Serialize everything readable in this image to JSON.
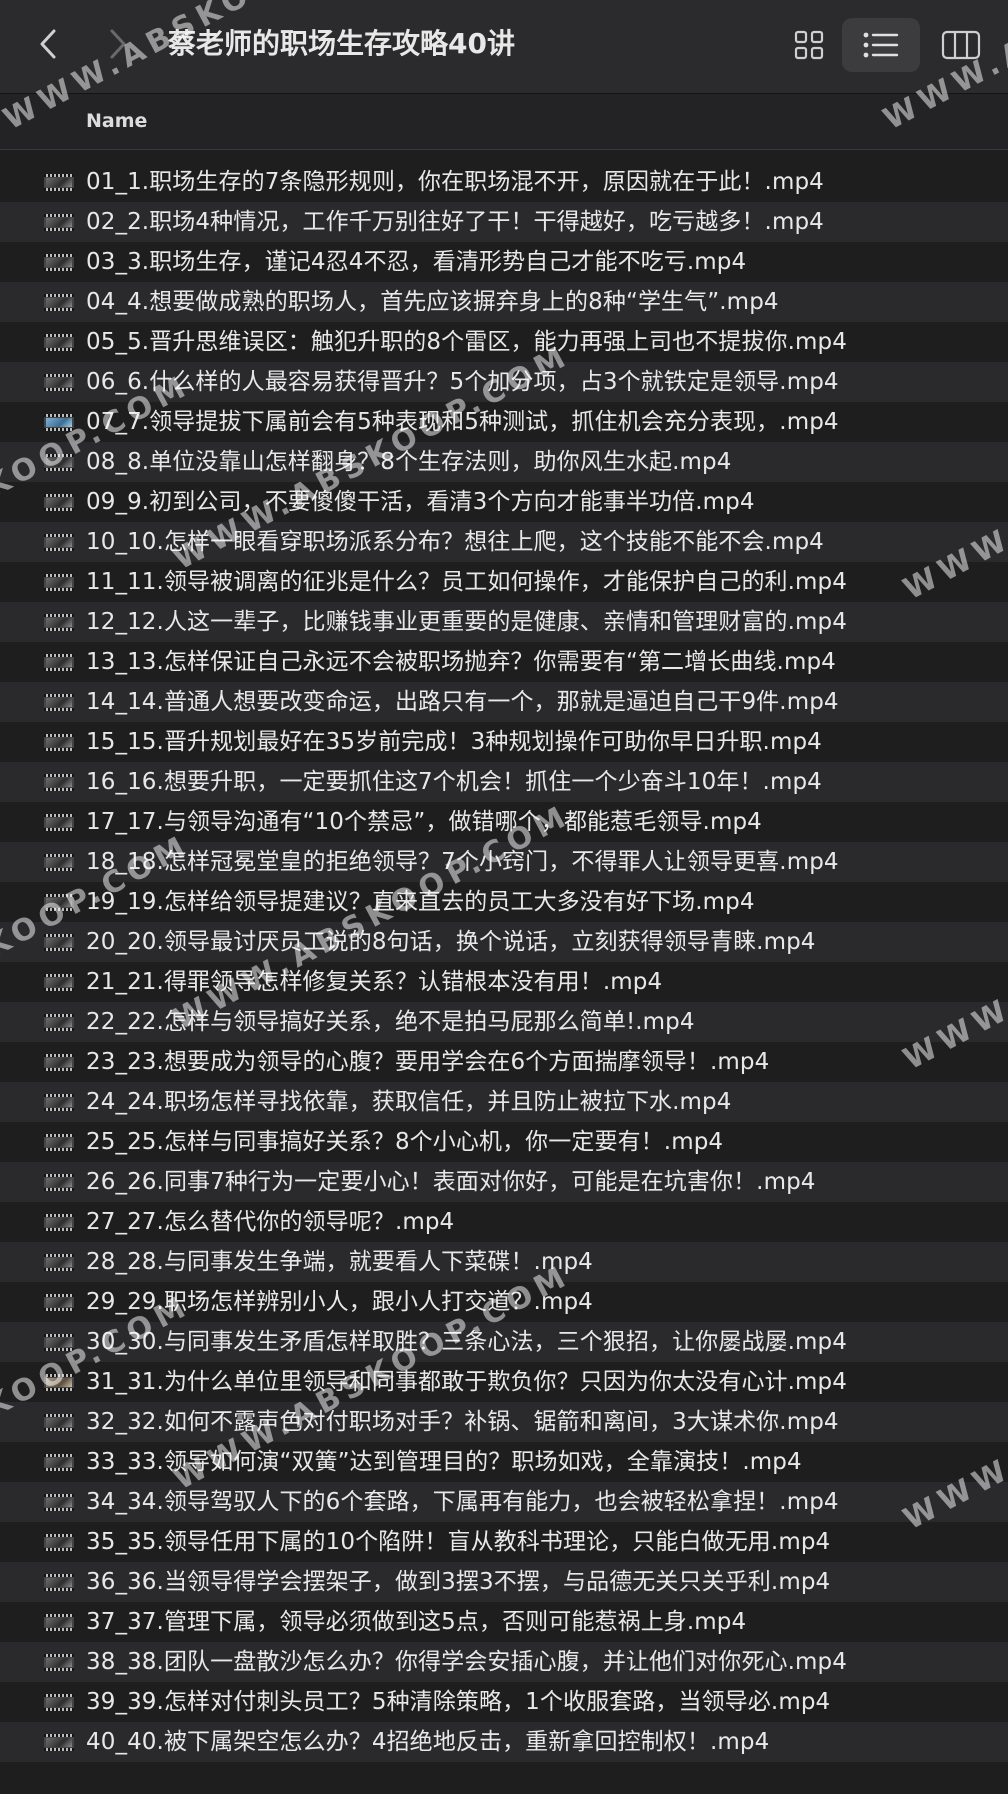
{
  "window": {
    "title": "蔡老师的职场生存攻略40讲"
  },
  "toolbar": {
    "back_icon": "chevron-left-icon",
    "forward_icon": "chevron-right-icon",
    "grid_icon": "grid-view-icon",
    "list_icon": "list-view-icon",
    "columns_icon": "column-view-icon",
    "active_view": "list"
  },
  "columns": {
    "name": "Name"
  },
  "files": [
    {
      "name": "01_1.职场生存的7条隐形规则，你在职场混不开，原因就在于此！.mp4",
      "thumb": "dark"
    },
    {
      "name": "02_2.职场4种情况，工作千万别往好了干！干得越好，吃亏越多！.mp4",
      "thumb": "dark"
    },
    {
      "name": "03_3.职场生存，谨记4忍4不忍，看清形势自己才能不吃亏.mp4",
      "thumb": "dark"
    },
    {
      "name": "04_4.想要做成熟的职场人，首先应该摒弃身上的8种“学生气”.mp4",
      "thumb": "dark"
    },
    {
      "name": "05_5.晋升思维误区：触犯升职的8个雷区，能力再强上司也不提拔你.mp4",
      "thumb": "dark"
    },
    {
      "name": "06_6.什么样的人最容易获得晋升？5个加分项，占3个就铁定是领导.mp4",
      "thumb": "dark"
    },
    {
      "name": "07_7.领导提拔下属前会有5种表现和5种测试，抓住机会充分表现，.mp4",
      "thumb": "blue"
    },
    {
      "name": "08_8.单位没靠山怎样翻身？8个生存法则，助你风生水起.mp4",
      "thumb": "dark"
    },
    {
      "name": "09_9.初到公司，不要傻傻干活，看清3个方向才能事半功倍.mp4",
      "thumb": "dark"
    },
    {
      "name": "10_10.怎样一眼看穿职场派系分布？想往上爬，这个技能不能不会.mp4",
      "thumb": "dark"
    },
    {
      "name": "11_11.领导被调离的征兆是什么？员工如何操作，才能保护自己的利.mp4",
      "thumb": "dark"
    },
    {
      "name": "12_12.人这一辈子，比赚钱事业更重要的是健康、亲情和管理财富的.mp4",
      "thumb": "dark"
    },
    {
      "name": "13_13.怎样保证自己永远不会被职场抛弃？你需要有“第二增长曲线.mp4",
      "thumb": "dark"
    },
    {
      "name": "14_14.普通人想要改变命运，出路只有一个，那就是逼迫自己干9件.mp4",
      "thumb": "dark"
    },
    {
      "name": "15_15.晋升规划最好在35岁前完成！3种规划操作可助你早日升职.mp4",
      "thumb": "dark"
    },
    {
      "name": "16_16.想要升职，一定要抓住这7个机会！抓住一个少奋斗10年！.mp4",
      "thumb": "dark"
    },
    {
      "name": "17_17.与领导沟通有“10个禁忌”，做错哪个，都能惹毛领导.mp4",
      "thumb": "dark"
    },
    {
      "name": "18_18.怎样冠冕堂皇的拒绝领导？7个小窍门，不得罪人让领导更喜.mp4",
      "thumb": "dark"
    },
    {
      "name": "19_19.怎样给领导提建议？直来直去的员工大多没有好下场.mp4",
      "thumb": "dark"
    },
    {
      "name": "20_20.领导最讨厌员工说的8句话，换个说话，立刻获得领导青睐.mp4",
      "thumb": "dark"
    },
    {
      "name": "21_21.得罪领导怎样修复关系？认错根本没有用！.mp4",
      "thumb": "dark"
    },
    {
      "name": "22_22.怎样与领导搞好关系，绝不是拍马屁那么简单!.mp4",
      "thumb": "dark"
    },
    {
      "name": "23_23.想要成为领导的心腹？要用学会在6个方面揣摩领导！.mp4",
      "thumb": "dark"
    },
    {
      "name": "24_24.职场怎样寻找依靠，获取信任，并且防止被拉下水.mp4",
      "thumb": "dark"
    },
    {
      "name": "25_25.怎样与同事搞好关系？8个小心机，你一定要有！.mp4",
      "thumb": "dark"
    },
    {
      "name": "26_26.同事7种行为一定要小心！表面对你好，可能是在坑害你！.mp4",
      "thumb": "dark"
    },
    {
      "name": "27_27.怎么替代你的领导呢？.mp4",
      "thumb": "dark"
    },
    {
      "name": "28_28.与同事发生争端，就要看人下菜碟！.mp4",
      "thumb": "dark"
    },
    {
      "name": "29_29.职场怎样辨别小人，跟小人打交道？.mp4",
      "thumb": "dark"
    },
    {
      "name": "30_30.与同事发生矛盾怎样取胜？三条心法，三个狠招，让你屡战屡.mp4",
      "thumb": "dark"
    },
    {
      "name": "31_31.为什么单位里领导和同事都敢于欺负你？只因为你太没有心计.mp4",
      "thumb": "warm"
    },
    {
      "name": "32_32.如何不露声色对付职场对手？补锅、锯箭和离间，3大谋术你.mp4",
      "thumb": "dark"
    },
    {
      "name": "33_33.领导如何演“双簧”达到管理目的？职场如戏，全靠演技！.mp4",
      "thumb": "dark"
    },
    {
      "name": "34_34.领导驾驭人下的6个套路，下属再有能力，也会被轻松拿捏！.mp4",
      "thumb": "dark"
    },
    {
      "name": "35_35.领导任用下属的10个陷阱！盲从教科书理论，只能白做无用.mp4",
      "thumb": "dark"
    },
    {
      "name": "36_36.当领导得学会摆架子，做到3摆3不摆，与品德无关只关乎利.mp4",
      "thumb": "dark"
    },
    {
      "name": "37_37.管理下属，领导必须做到这5点，否则可能惹祸上身.mp4",
      "thumb": "dark"
    },
    {
      "name": "38_38.团队一盘散沙怎么办？你得学会安插心腹，并让他们对你死心.mp4",
      "thumb": "dark"
    },
    {
      "name": "39_39.怎样对付刺头员工？5种清除策略，1个收服套路，当领导必.mp4",
      "thumb": "dark"
    },
    {
      "name": "40_40.被下属架空怎么办？4招绝地反击，重新拿回控制权！.mp4",
      "thumb": "dark"
    }
  ],
  "watermarks": [
    "WWW.ABSKOOP.COM"
  ]
}
